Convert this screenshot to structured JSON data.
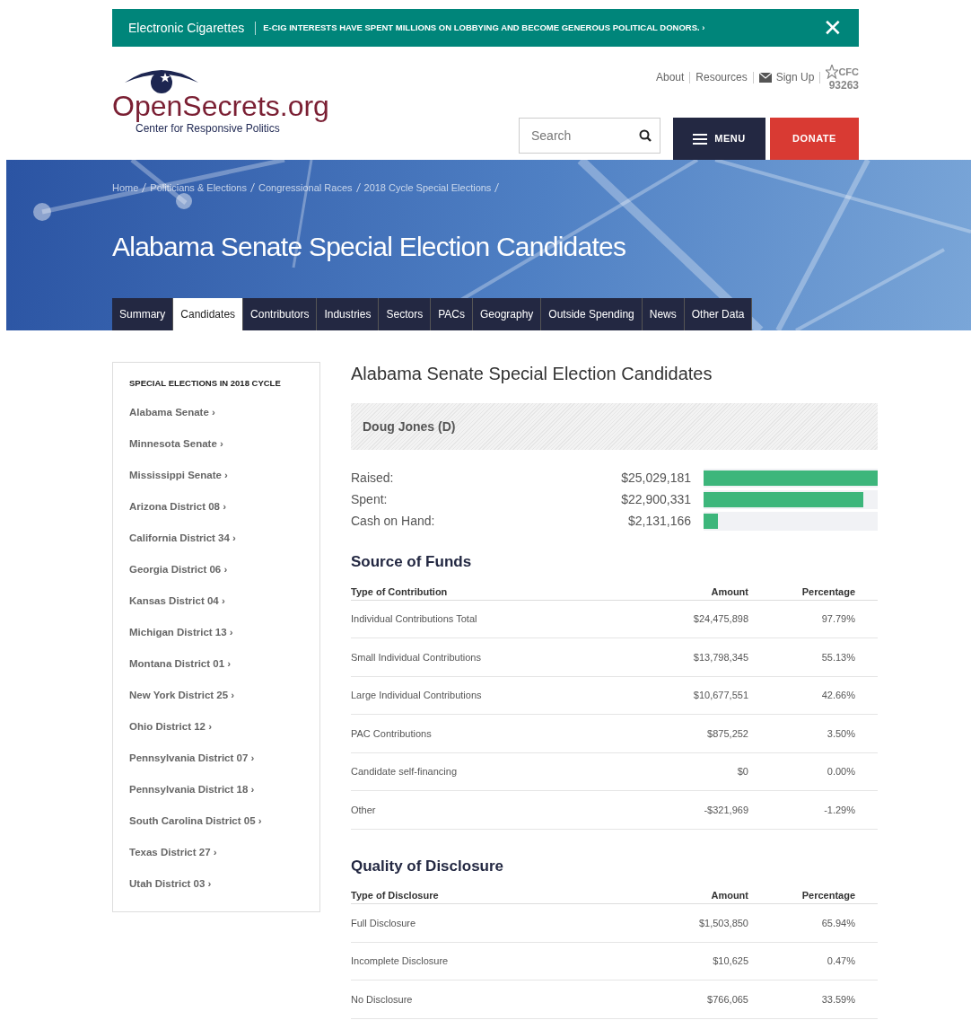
{
  "alert": {
    "topic": "Electronic Cigarettes",
    "message": "E-CIG INTERESTS HAVE SPENT MILLIONS ON LOBBYING AND BECOME GENEROUS POLITICAL DONORS. ›",
    "close": "✕"
  },
  "logo": {
    "name": "OpenSecrets.org",
    "tagline": "Center for Responsive Politics"
  },
  "top_links": [
    {
      "label": "About",
      "kind": "link"
    },
    {
      "label": "Resources",
      "kind": "link"
    },
    {
      "label": "Sign Up",
      "kind": "mail"
    }
  ],
  "cfc": {
    "label": "CFC",
    "number": "93263"
  },
  "search": {
    "placeholder": "Search"
  },
  "menu_button": "MENU",
  "donate_button": "DONATE",
  "breadcrumbs": [
    "Home",
    "Politicians & Elections",
    "Congressional Races",
    "2018 Cycle Special Elections"
  ],
  "page_title": "Alabama Senate Special Election Candidates",
  "tabs": [
    {
      "label": "Summary",
      "selected": false
    },
    {
      "label": "Candidates",
      "selected": true
    },
    {
      "label": "Contributors",
      "selected": false
    },
    {
      "label": "Industries",
      "selected": false
    },
    {
      "label": "Sectors",
      "selected": false
    },
    {
      "label": "PACs",
      "selected": false
    },
    {
      "label": "Geography",
      "selected": false
    },
    {
      "label": "Outside Spending",
      "selected": false
    },
    {
      "label": "News",
      "selected": false
    },
    {
      "label": "Other Data",
      "selected": false
    }
  ],
  "sidebar": {
    "title": "SPECIAL ELECTIONS IN 2018 CYCLE",
    "items": [
      "Alabama Senate ›",
      "Minnesota Senate ›",
      "Mississippi Senate ›",
      "Arizona District 08 ›",
      "California District 34 ›",
      "Georgia District 06 ›",
      "Kansas District 04 ›",
      "Michigan District 13 ›",
      "Montana District 01 ›",
      "New York District 25 ›",
      "Ohio District 12 ›",
      "Pennsylvania District 07 ›",
      "Pennsylvania District 18 ›",
      "South Carolina District 05 ›",
      "Texas District 27 ›",
      "Utah District 03 ›"
    ]
  },
  "main_title": "Alabama Senate Special Election Candidates",
  "candidate": "Doug Jones (D)",
  "money": [
    {
      "label": "Raised:",
      "amount": "$25,029,181",
      "level": 1.0
    },
    {
      "label": "Spent:",
      "amount": "$22,900,331",
      "level": 0.915
    },
    {
      "label": "Cash on Hand:",
      "amount": "$2,131,166",
      "level": 0.085
    }
  ],
  "tables": [
    {
      "title": "Source of Funds",
      "columns": [
        "Type of Contribution",
        "Amount",
        "Percentage"
      ],
      "rows": [
        [
          "Individual Contributions Total",
          "$24,475,898",
          "97.79%"
        ],
        [
          "Small Individual Contributions",
          "$13,798,345",
          "55.13%"
        ],
        [
          "Large Individual Contributions",
          "$10,677,551",
          "42.66%"
        ],
        [
          "PAC Contributions",
          "$875,252",
          "3.50%"
        ],
        [
          "Candidate self-financing",
          "$0",
          "0.00%"
        ],
        [
          "Other",
          "-$321,969",
          "-1.29%"
        ]
      ]
    },
    {
      "title": "Quality of Disclosure",
      "columns": [
        "Type of Disclosure",
        "Amount",
        "Percentage"
      ],
      "rows": [
        [
          "Full Disclosure",
          "$1,503,850",
          "65.94%"
        ],
        [
          "Incomplete Disclosure",
          "$10,625",
          "0.47%"
        ],
        [
          "No Disclosure",
          "$766,065",
          "33.59%"
        ]
      ]
    }
  ]
}
